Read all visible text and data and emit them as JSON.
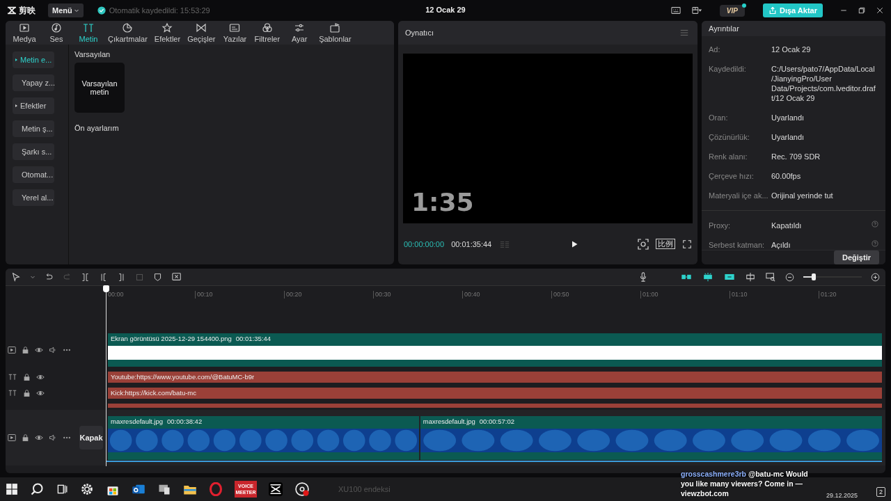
{
  "app_bar": {
    "logo": "剪映",
    "menu": "Menü",
    "autosave": "Otomatik kaydedildi: 15:53:29",
    "title": "12 Ocak 29",
    "vip": "VIP",
    "export": "Dışa Aktar"
  },
  "tabs": [
    {
      "label": "Medya",
      "selected": false
    },
    {
      "label": "Ses",
      "selected": false
    },
    {
      "label": "Metin",
      "selected": true
    },
    {
      "label": "Çıkartmalar",
      "selected": false
    },
    {
      "label": "Efektler",
      "selected": false
    },
    {
      "label": "Geçişler",
      "selected": false
    },
    {
      "label": "Yazılar",
      "selected": false
    },
    {
      "label": "Filtreler",
      "selected": false
    },
    {
      "label": "Ayar",
      "selected": false
    },
    {
      "label": "Şablonlar",
      "selected": false
    }
  ],
  "sidebar": {
    "items": [
      {
        "label": "Metin e...",
        "selected": true,
        "expandable": true
      },
      {
        "label": "Yapay z...",
        "selected": false,
        "expandable": false
      },
      {
        "label": "Efektler",
        "selected": false,
        "expandable": true
      },
      {
        "label": "Metin ş...",
        "selected": false,
        "expandable": false
      },
      {
        "label": "Şarkı s...",
        "selected": false,
        "expandable": false
      },
      {
        "label": "Otomat...",
        "selected": false,
        "expandable": false
      },
      {
        "label": "Yerel al...",
        "selected": false,
        "expandable": false
      }
    ]
  },
  "library": {
    "heading": "Varsayılan",
    "card": "Varsayılan metin",
    "presets": "Ön ayarlarım"
  },
  "player": {
    "title": "Oynatıcı",
    "overlay": "1:35",
    "current": "00:00:00:00",
    "duration": "00:01:35:44",
    "ratio_label": "比例"
  },
  "details": {
    "title": "Ayrıntılar",
    "rows": [
      {
        "label": "Ad:",
        "value": "12 Ocak 29"
      },
      {
        "label": "Kaydedildi:",
        "value": "C:/Users/pato7/AppData/Local/JianyingPro/User Data/Projects/com.lveditor.draft/12 Ocak 29"
      },
      {
        "label": "Oran:",
        "value": "Uyarlandı"
      },
      {
        "label": "Çözünürlük:",
        "value": "Uyarlandı"
      },
      {
        "label": "Renk alanı:",
        "value": "Rec. 709 SDR"
      },
      {
        "label": "Çerçeve hızı:",
        "value": "60.00fps"
      },
      {
        "label": "Materyali içe ak...",
        "value": "Orijinal yerinde tut"
      }
    ],
    "settings": [
      {
        "label": "Proxy:",
        "value": "Kapatıldı"
      },
      {
        "label": "Serbest katman:",
        "value": "Açıldı"
      }
    ],
    "button": "Değiştir"
  },
  "timeline": {
    "ruler": [
      "00:00",
      "00:10",
      "00:20",
      "00:30",
      "00:40",
      "00:50",
      "01:00",
      "01:10",
      "01:20"
    ],
    "zoom": {
      "level": 0.18
    },
    "tracks": [
      {
        "kind": "video",
        "clips": [
          {
            "kind": "blank",
            "name": "Ekran görüntüsü 2025-12-29 154400.png",
            "duration": "00:01:35:44"
          }
        ]
      },
      {
        "kind": "text",
        "clips": [
          {
            "name": "Youtube:https://www.youtube.com/@BatuMC-b9r"
          }
        ]
      },
      {
        "kind": "text",
        "clips": [
          {
            "name": "Kick:https://kick.com/batu-mc"
          }
        ]
      },
      {
        "kind": "text_cut"
      },
      {
        "kind": "main",
        "cover": "Kapak",
        "clips": [
          {
            "kind": "picture",
            "name": "maxresdefault.jpg",
            "duration": "00:00:38:42"
          },
          {
            "kind": "picture",
            "name": "maxresdefault.jpg",
            "duration": "00:00:57:02"
          }
        ]
      }
    ]
  },
  "taskbar": {
    "meeter_badge": [
      "VOICE",
      "MEETER"
    ],
    "news": "XU100 endeksi",
    "date": "29.12.2025",
    "notifications": "2"
  },
  "chat_overlay": {
    "user": "grosscashmere3rb",
    "message": "@batu-mc Would you like many viewers? Come in — viewzbot.com"
  }
}
